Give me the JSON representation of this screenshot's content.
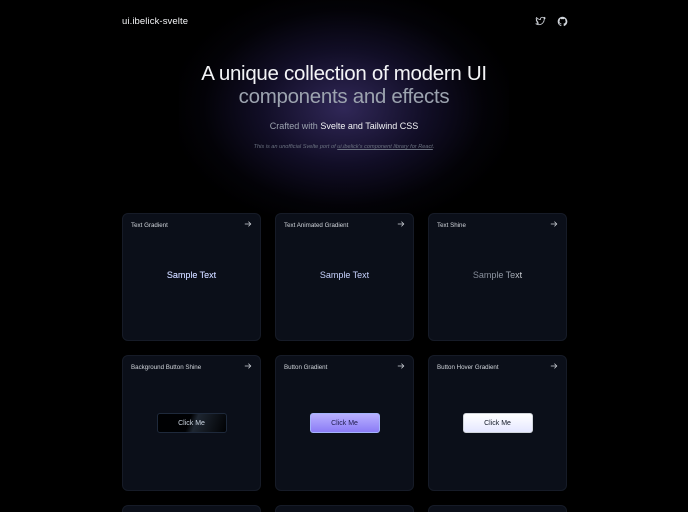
{
  "header": {
    "brand": "ui.ibelick-svelte",
    "icons": [
      "twitter-icon",
      "github-icon"
    ]
  },
  "hero": {
    "title_line1": "A unique collection of modern UI",
    "title_line2": "components and effects",
    "subtitle_prefix": "Crafted with",
    "subtitle_emphasis": "Svelte and Tailwind CSS",
    "note_prefix": "This is an unofficial Svelte port of",
    "note_link": "ui.ibelick's component library for React",
    "note_suffix": "."
  },
  "cards": [
    {
      "title": "Text Gradient",
      "demo": "Sample Text"
    },
    {
      "title": "Text Animated Gradient",
      "demo": "Sample Text"
    },
    {
      "title": "Text Shine",
      "demo": "Sample Text"
    },
    {
      "title": "Background Button Shine",
      "demo": "Click Me"
    },
    {
      "title": "Button Gradient",
      "demo": "Click Me"
    },
    {
      "title": "Button Hover Gradient",
      "demo": "Click Me"
    }
  ],
  "colors": {
    "background": "#000000",
    "card": "#0b0f19",
    "accent": "#8b7cf6"
  }
}
